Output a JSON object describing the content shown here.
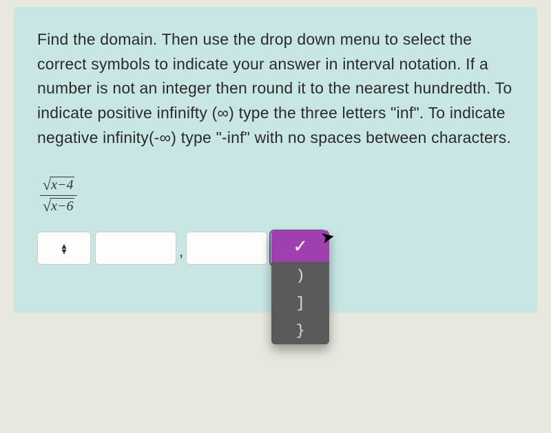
{
  "question": "Find the domain. Then use the drop down menu to select the correct symbols to indicate your answer in interval notation. If a number is not an integer then round it to the nearest hundredth. To indicate positive infinifty (∞) type the three letters \"inf\". To indicate negative infinity(-∞) type \"-inf\" with no spaces between characters.",
  "expression": {
    "numerator_radicand": "x−4",
    "denominator_radicand": "x−6"
  },
  "dropdown": {
    "selected_glyph": "✓",
    "options": [
      ")",
      "]",
      "}"
    ]
  },
  "comma": ","
}
